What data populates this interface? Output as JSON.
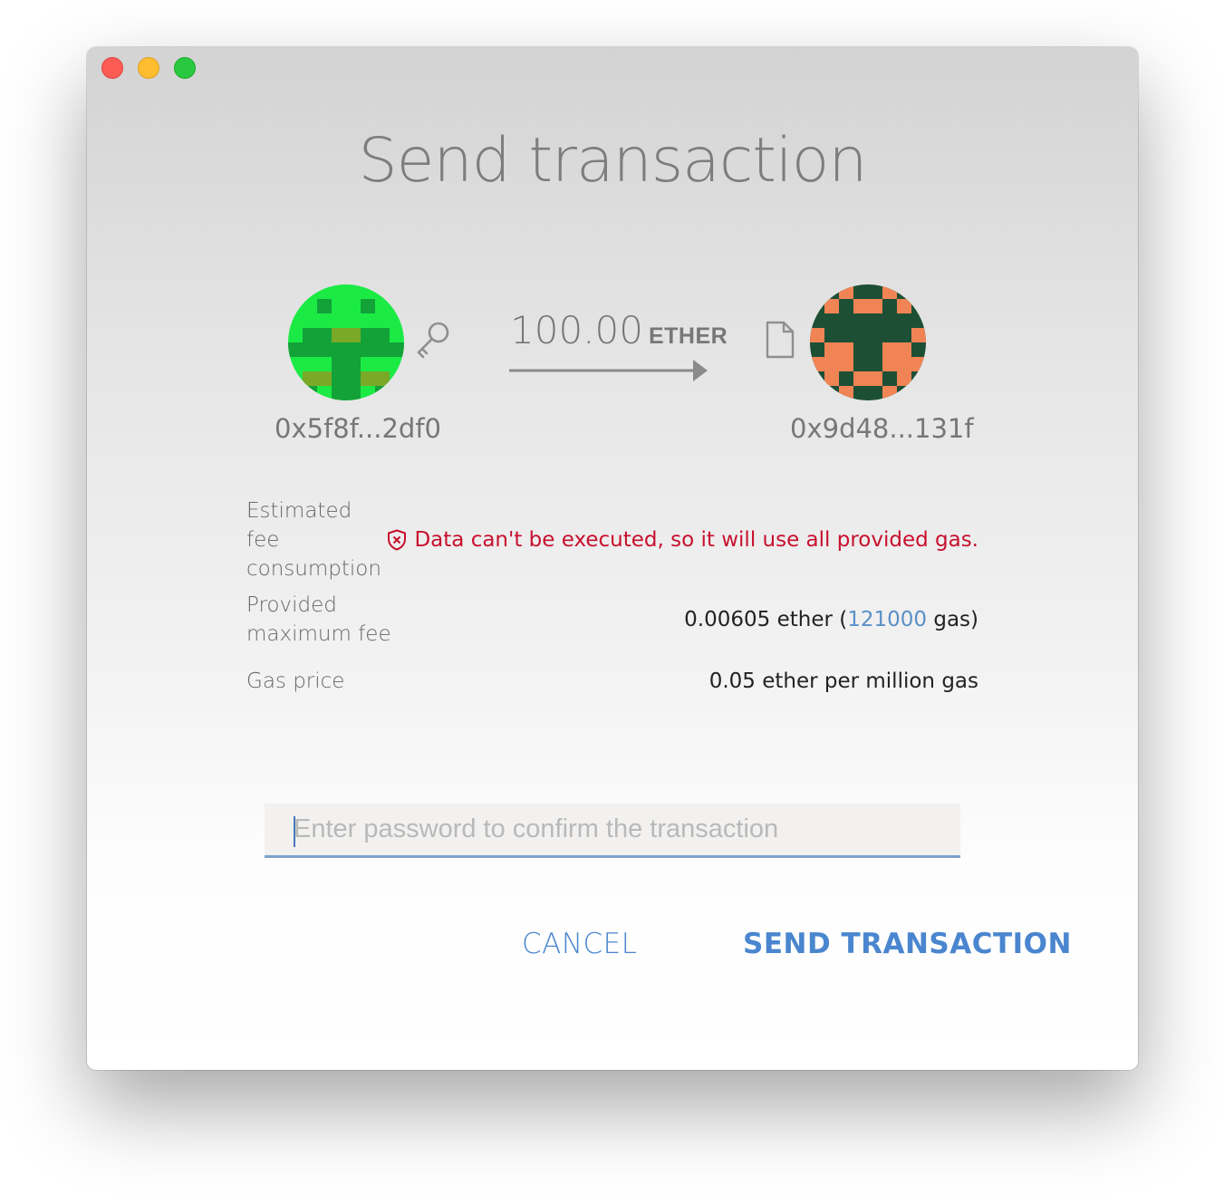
{
  "window": {
    "controls": [
      "close",
      "minimize",
      "zoom"
    ]
  },
  "title": "Send transaction",
  "from": {
    "address": "0x5f8f...2df0",
    "icon": "key-icon"
  },
  "to": {
    "address": "0x9d48...131f",
    "icon": "document-icon"
  },
  "amount": {
    "value": "100.00",
    "unit": "ETHER"
  },
  "details": {
    "estimated_fee_label_line1": "Estimated fee",
    "estimated_fee_label_line2": "consumption",
    "warning": "Data can't be executed, so it will use all provided gas.",
    "max_fee_label_line1": "Provided",
    "max_fee_label_line2": "maximum fee",
    "max_fee_prefix": "0.00605 ether (",
    "max_fee_gas": "121000",
    "max_fee_suffix": " gas)",
    "gas_price_label": "Gas price",
    "gas_price_value": "0.05 ether per million gas"
  },
  "password": {
    "placeholder": "Enter password to confirm the transaction",
    "value": ""
  },
  "buttons": {
    "cancel": "CANCEL",
    "send": "SEND TRANSACTION"
  },
  "colors": {
    "accent": "#4a86cf",
    "warning": "#c8102e",
    "gas_link": "#5a8fc7",
    "input_underline": "#7da1c9"
  }
}
